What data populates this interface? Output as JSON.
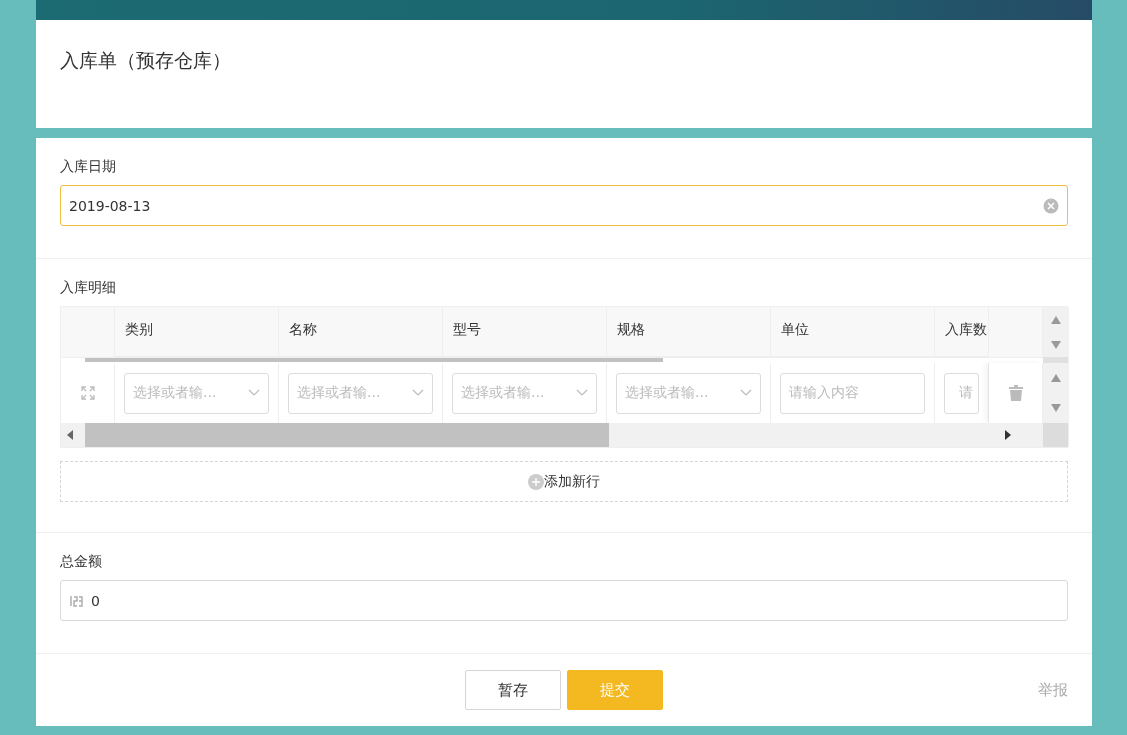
{
  "title": "入库单（预存仓库）",
  "date_field": {
    "label": "入库日期",
    "value": "2019-08-13"
  },
  "details": {
    "label": "入库明细",
    "columns": [
      "类别",
      "名称",
      "型号",
      "规格",
      "单位",
      "入库数"
    ],
    "rows": [
      {
        "cells": [
          {
            "kind": "select",
            "placeholder": "选择或者输..."
          },
          {
            "kind": "select",
            "placeholder": "选择或者输..."
          },
          {
            "kind": "select",
            "placeholder": "选择或者输..."
          },
          {
            "kind": "select",
            "placeholder": "选择或者输..."
          },
          {
            "kind": "text",
            "placeholder": "请输入内容"
          },
          {
            "kind": "number",
            "placeholder": "请"
          }
        ]
      }
    ],
    "add_row": "添加新行"
  },
  "total_field": {
    "label": "总金额",
    "value": "0"
  },
  "buttons": [
    {
      "label": "暂存",
      "kind": "secondary"
    },
    {
      "label": "提交",
      "kind": "primary"
    }
  ],
  "report_link": "举报"
}
